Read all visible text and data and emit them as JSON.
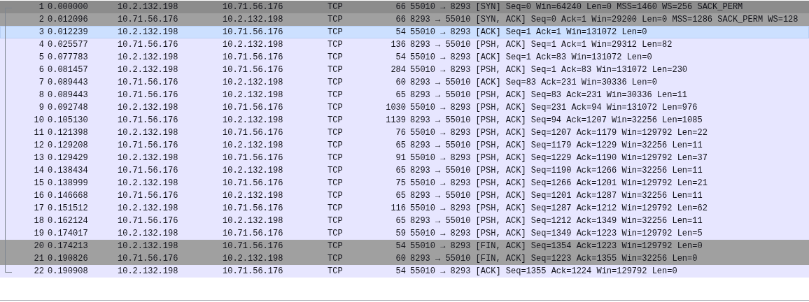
{
  "packet_list": {
    "rows": [
      {
        "no": "1",
        "time": "0.000000",
        "source": "10.2.132.198",
        "destination": "10.71.56.176",
        "protocol": "TCP",
        "length": "66",
        "info": "55010 → 8293 [SYN] Seq=0 Win=64240 Len=0 MSS=1460 WS=256 SACK_PERM",
        "color": "#8c8c8c",
        "selected": false
      },
      {
        "no": "2",
        "time": "0.012096",
        "source": "10.71.56.176",
        "destination": "10.2.132.198",
        "protocol": "TCP",
        "length": "66",
        "info": "8293 → 55010 [SYN, ACK] Seq=0 Ack=1 Win=29200 Len=0 MSS=1286 SACK_PERM WS=128",
        "color": "#a0a0a0",
        "selected": false
      },
      {
        "no": "3",
        "time": "0.012239",
        "source": "10.2.132.198",
        "destination": "10.71.56.176",
        "protocol": "TCP",
        "length": "54",
        "info": "55010 → 8293 [ACK] Seq=1 Ack=1 Win=131072 Len=0",
        "color": "#cce0ff",
        "selected": true
      },
      {
        "no": "4",
        "time": "0.025577",
        "source": "10.71.56.176",
        "destination": "10.2.132.198",
        "protocol": "TCP",
        "length": "136",
        "info": "8293 → 55010 [PSH, ACK] Seq=1 Ack=1 Win=29312 Len=82",
        "color": "#e7e6ff",
        "selected": false
      },
      {
        "no": "5",
        "time": "0.077783",
        "source": "10.2.132.198",
        "destination": "10.71.56.176",
        "protocol": "TCP",
        "length": "54",
        "info": "55010 → 8293 [ACK] Seq=1 Ack=83 Win=131072 Len=0",
        "color": "#e7e6ff",
        "selected": false
      },
      {
        "no": "6",
        "time": "0.081457",
        "source": "10.2.132.198",
        "destination": "10.71.56.176",
        "protocol": "TCP",
        "length": "284",
        "info": "55010 → 8293 [PSH, ACK] Seq=1 Ack=83 Win=131072 Len=230",
        "color": "#e7e6ff",
        "selected": false
      },
      {
        "no": "7",
        "time": "0.089443",
        "source": "10.71.56.176",
        "destination": "10.2.132.198",
        "protocol": "TCP",
        "length": "60",
        "info": "8293 → 55010 [ACK] Seq=83 Ack=231 Win=30336 Len=0",
        "color": "#e7e6ff",
        "selected": false
      },
      {
        "no": "8",
        "time": "0.089443",
        "source": "10.71.56.176",
        "destination": "10.2.132.198",
        "protocol": "TCP",
        "length": "65",
        "info": "8293 → 55010 [PSH, ACK] Seq=83 Ack=231 Win=30336 Len=11",
        "color": "#e7e6ff",
        "selected": false
      },
      {
        "no": "9",
        "time": "0.092748",
        "source": "10.2.132.198",
        "destination": "10.71.56.176",
        "protocol": "TCP",
        "length": "1030",
        "info": "55010 → 8293 [PSH, ACK] Seq=231 Ack=94 Win=131072 Len=976",
        "color": "#e7e6ff",
        "selected": false
      },
      {
        "no": "10",
        "time": "0.105130",
        "source": "10.71.56.176",
        "destination": "10.2.132.198",
        "protocol": "TCP",
        "length": "1139",
        "info": "8293 → 55010 [PSH, ACK] Seq=94 Ack=1207 Win=32256 Len=1085",
        "color": "#e7e6ff",
        "selected": false
      },
      {
        "no": "11",
        "time": "0.121398",
        "source": "10.2.132.198",
        "destination": "10.71.56.176",
        "protocol": "TCP",
        "length": "76",
        "info": "55010 → 8293 [PSH, ACK] Seq=1207 Ack=1179 Win=129792 Len=22",
        "color": "#e7e6ff",
        "selected": false
      },
      {
        "no": "12",
        "time": "0.129208",
        "source": "10.71.56.176",
        "destination": "10.2.132.198",
        "protocol": "TCP",
        "length": "65",
        "info": "8293 → 55010 [PSH, ACK] Seq=1179 Ack=1229 Win=32256 Len=11",
        "color": "#e7e6ff",
        "selected": false
      },
      {
        "no": "13",
        "time": "0.129429",
        "source": "10.2.132.198",
        "destination": "10.71.56.176",
        "protocol": "TCP",
        "length": "91",
        "info": "55010 → 8293 [PSH, ACK] Seq=1229 Ack=1190 Win=129792 Len=37",
        "color": "#e7e6ff",
        "selected": false
      },
      {
        "no": "14",
        "time": "0.138434",
        "source": "10.71.56.176",
        "destination": "10.2.132.198",
        "protocol": "TCP",
        "length": "65",
        "info": "8293 → 55010 [PSH, ACK] Seq=1190 Ack=1266 Win=32256 Len=11",
        "color": "#e7e6ff",
        "selected": false
      },
      {
        "no": "15",
        "time": "0.138999",
        "source": "10.2.132.198",
        "destination": "10.71.56.176",
        "protocol": "TCP",
        "length": "75",
        "info": "55010 → 8293 [PSH, ACK] Seq=1266 Ack=1201 Win=129792 Len=21",
        "color": "#e7e6ff",
        "selected": false
      },
      {
        "no": "16",
        "time": "0.146668",
        "source": "10.71.56.176",
        "destination": "10.2.132.198",
        "protocol": "TCP",
        "length": "65",
        "info": "8293 → 55010 [PSH, ACK] Seq=1201 Ack=1287 Win=32256 Len=11",
        "color": "#e7e6ff",
        "selected": false
      },
      {
        "no": "17",
        "time": "0.151512",
        "source": "10.2.132.198",
        "destination": "10.71.56.176",
        "protocol": "TCP",
        "length": "116",
        "info": "55010 → 8293 [PSH, ACK] Seq=1287 Ack=1212 Win=129792 Len=62",
        "color": "#e7e6ff",
        "selected": false
      },
      {
        "no": "18",
        "time": "0.162124",
        "source": "10.71.56.176",
        "destination": "10.2.132.198",
        "protocol": "TCP",
        "length": "65",
        "info": "8293 → 55010 [PSH, ACK] Seq=1212 Ack=1349 Win=32256 Len=11",
        "color": "#e7e6ff",
        "selected": false
      },
      {
        "no": "19",
        "time": "0.174017",
        "source": "10.2.132.198",
        "destination": "10.71.56.176",
        "protocol": "TCP",
        "length": "59",
        "info": "55010 → 8293 [PSH, ACK] Seq=1349 Ack=1223 Win=129792 Len=5",
        "color": "#e7e6ff",
        "selected": false
      },
      {
        "no": "20",
        "time": "0.174213",
        "source": "10.2.132.198",
        "destination": "10.71.56.176",
        "protocol": "TCP",
        "length": "54",
        "info": "55010 → 8293 [FIN, ACK] Seq=1354 Ack=1223 Win=129792 Len=0",
        "color": "#a0a0a0",
        "selected": false
      },
      {
        "no": "21",
        "time": "0.190826",
        "source": "10.71.56.176",
        "destination": "10.2.132.198",
        "protocol": "TCP",
        "length": "60",
        "info": "8293 → 55010 [FIN, ACK] Seq=1223 Ack=1355 Win=32256 Len=0",
        "color": "#a0a0a0",
        "selected": false
      },
      {
        "no": "22",
        "time": "0.190908",
        "source": "10.2.132.198",
        "destination": "10.71.56.176",
        "protocol": "TCP",
        "length": "54",
        "info": "55010 → 8293 [ACK] Seq=1355 Ack=1224 Win=129792 Len=0",
        "color": "#e7e6ff",
        "selected": false
      }
    ]
  }
}
